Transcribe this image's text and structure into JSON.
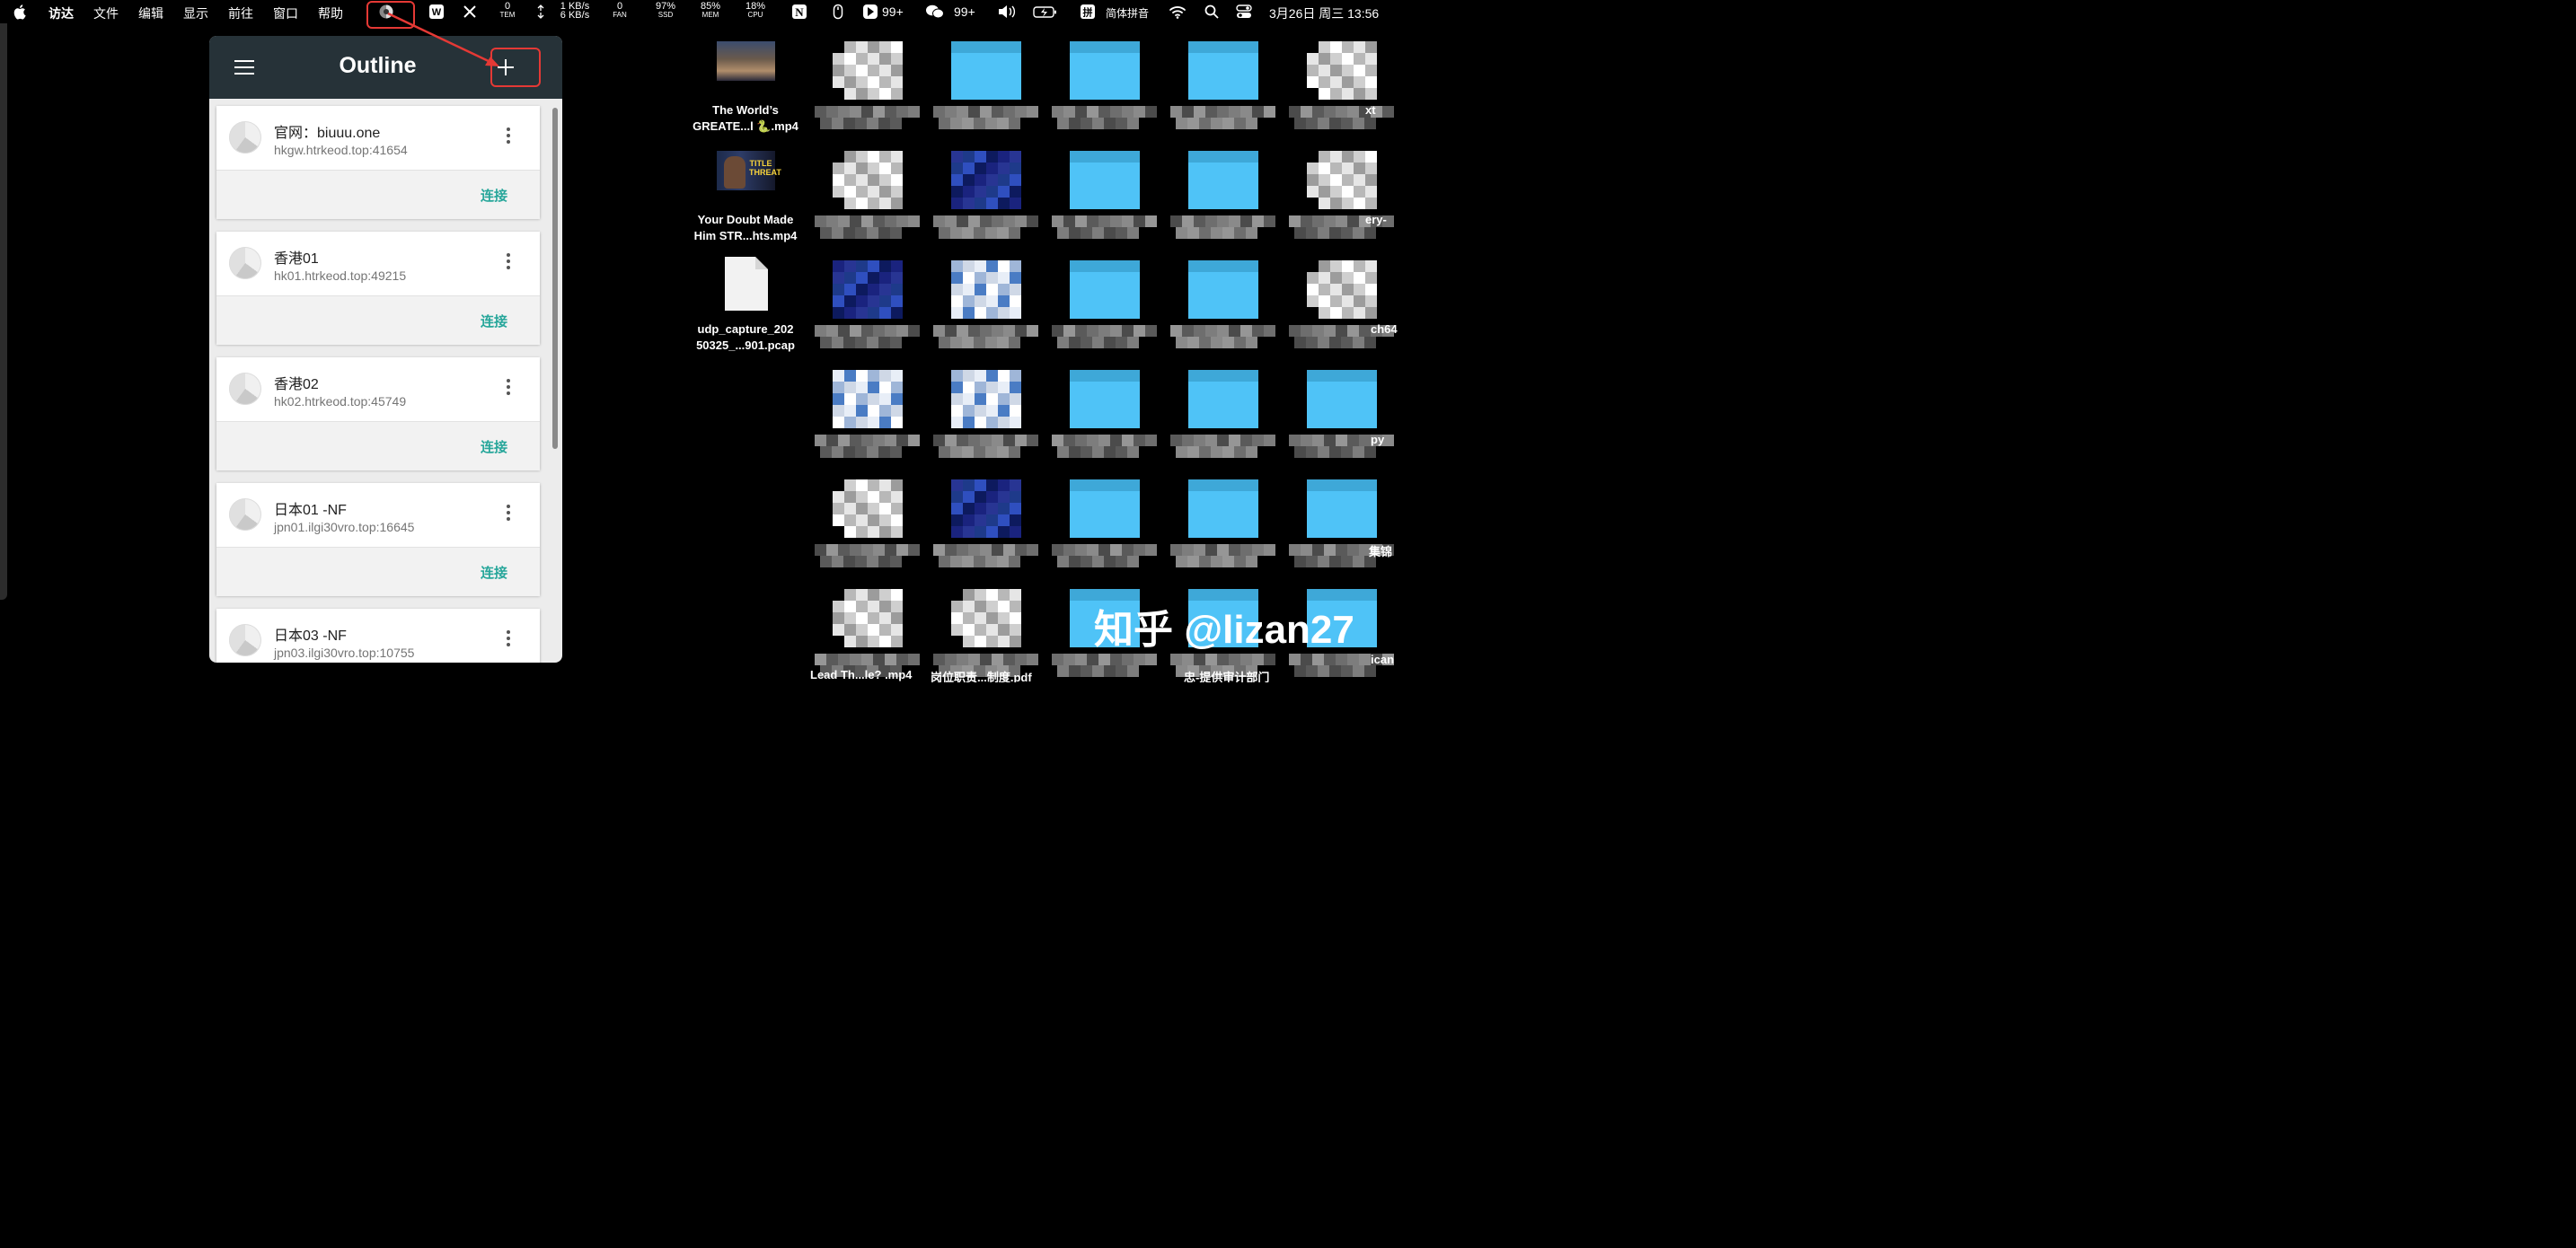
{
  "menubar": {
    "menus": [
      "访达",
      "文件",
      "编辑",
      "显示",
      "前往",
      "窗口",
      "帮助"
    ],
    "stats": [
      {
        "value": "0",
        "label": "TEM"
      },
      {
        "value": "1 KB/s",
        "label": "6 KB/s"
      },
      {
        "value": "0",
        "label": "FAN"
      },
      {
        "value": "97%",
        "label": "SSD"
      },
      {
        "value": "85%",
        "label": "MEM"
      },
      {
        "value": "18%",
        "label": "CPU"
      }
    ],
    "badge1": "99+",
    "badge2": "99+",
    "input_method": "简体拼音",
    "datetime": "3月26日 周三 13:56",
    "icons": [
      "apple-logo",
      "outline-app-icon",
      "wps-icon",
      "x-icon",
      "network-arrows-icon",
      "notion-icon",
      "mouse-icon",
      "app-badge-icon",
      "wechat-icon",
      "volume-icon",
      "battery-icon",
      "pinyin-icon",
      "wifi-icon",
      "search-icon",
      "control-center-icon"
    ]
  },
  "outline": {
    "title": "Outline",
    "servers": [
      {
        "name": "官网：biuuu.one",
        "host": "hkgw.htrkeod.top:41654",
        "action": "连接"
      },
      {
        "name": "香港01",
        "host": "hk01.htrkeod.top:49215",
        "action": "连接"
      },
      {
        "name": "香港02",
        "host": "hk02.htrkeod.top:45749",
        "action": "连接"
      },
      {
        "name": "日本01 -NF",
        "host": "jpn01.ilgi30vro.top:16645",
        "action": "连接"
      },
      {
        "name": "日本03 -NF",
        "host": "jpn03.ilgi30vro.top:10755",
        "action": "连接"
      }
    ]
  },
  "desktop": {
    "files": [
      {
        "line1": "The World’s",
        "line2": "GREATE...l 🐍.mp4"
      },
      {
        "line1": "Your Doubt Made",
        "line2": "Him STR...hts.mp4"
      },
      {
        "line1": "udp_capture_202",
        "line2": "50325_...901.pcap"
      }
    ],
    "thumb2_text": "TITLE THREAT",
    "edge_labels": [
      "xt",
      "ery-",
      "ch64",
      "py",
      "集锦",
      "ican"
    ],
    "bottom_labels": [
      "Lead Th...le? .mp4",
      "岗位职责...制度.pdf",
      "忠-提供审计部门"
    ],
    "watermark": "知乎 @lizan27",
    "colors": {
      "folder": "#4fc3f7",
      "outline_header": "#263238",
      "connect": "#26a69a",
      "highlight": "#e53935"
    }
  }
}
